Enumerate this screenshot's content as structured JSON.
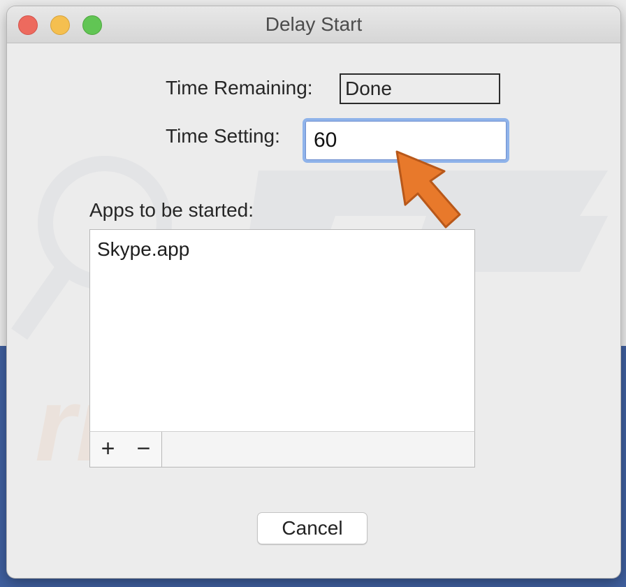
{
  "window": {
    "title": "Delay Start"
  },
  "form": {
    "time_remaining_label": "Time Remaining:",
    "time_remaining_value": "Done",
    "time_setting_label": "Time Setting:",
    "time_setting_value": "60",
    "apps_label": "Apps to be started:"
  },
  "apps": {
    "items": [
      "Skype.app"
    ],
    "add_label": "+",
    "remove_label": "−"
  },
  "buttons": {
    "cancel_label": "Cancel"
  },
  "colors": {
    "close": "#ed6a5e",
    "minimize": "#f5bf4f",
    "maximize": "#61c554",
    "focus_ring": "#8fb3ea",
    "annotation_arrow": "#e8792b"
  }
}
